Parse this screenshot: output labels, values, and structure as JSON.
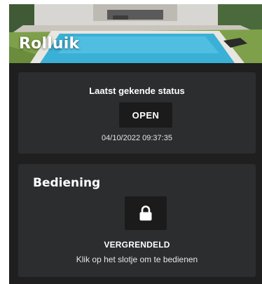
{
  "header": {
    "title": "Rolluik"
  },
  "status_card": {
    "heading": "Laatst gekende status",
    "status": "OPEN",
    "timestamp": "04/10/2022 09:37:35"
  },
  "control_card": {
    "title": "Bediening",
    "lock_icon": "padlock-icon",
    "lock_state": "VERGRENDELD",
    "hint": "Klik op het slotje om te bedienen"
  },
  "colors": {
    "background": "#1f1f20",
    "card": "#2c2d2f",
    "button": "#1b1b1c",
    "text": "#ffffff"
  }
}
